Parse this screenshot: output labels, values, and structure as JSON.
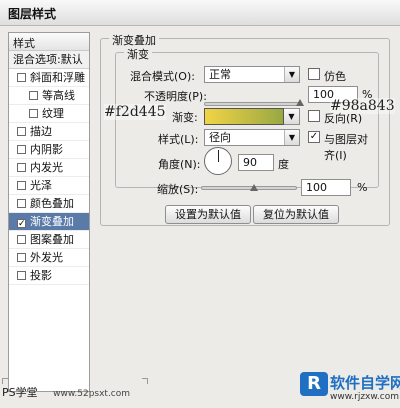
{
  "window": {
    "title": "图层样式"
  },
  "style_list": {
    "header": "样式",
    "blend_options": "混合选项:默认",
    "items": [
      {
        "label": "斜面和浮雕",
        "checked": false,
        "sub": false
      },
      {
        "label": "等高线",
        "checked": false,
        "sub": true
      },
      {
        "label": "纹理",
        "checked": false,
        "sub": true
      },
      {
        "label": "描边",
        "checked": false,
        "sub": false
      },
      {
        "label": "内阴影",
        "checked": false,
        "sub": false
      },
      {
        "label": "内发光",
        "checked": false,
        "sub": false
      },
      {
        "label": "光泽",
        "checked": false,
        "sub": false
      },
      {
        "label": "颜色叠加",
        "checked": false,
        "sub": false
      },
      {
        "label": "渐变叠加",
        "checked": true,
        "sub": false,
        "selected": true
      },
      {
        "label": "图案叠加",
        "checked": false,
        "sub": false
      },
      {
        "label": "外发光",
        "checked": false,
        "sub": false
      },
      {
        "label": "投影",
        "checked": false,
        "sub": false
      }
    ]
  },
  "panel": {
    "section_title": "渐变叠加",
    "group_title": "渐变",
    "blend_mode": {
      "label": "混合模式(O):",
      "value": "正常"
    },
    "dither": {
      "label": "仿色",
      "checked": false
    },
    "opacity": {
      "label": "不透明度(P):",
      "value": "100",
      "unit": "%",
      "level": 1.0
    },
    "gradient": {
      "label": "渐变:",
      "color_start": "#f2d445",
      "color_end": "#98a843"
    },
    "reverse": {
      "label": "反向(R)",
      "checked": false
    },
    "style": {
      "label": "样式(L):",
      "value": "径向"
    },
    "align_with_layer": {
      "label": "与图层对齐(I)",
      "checked": true
    },
    "angle": {
      "label": "角度(N):",
      "value": "90",
      "unit": "度"
    },
    "scale": {
      "label": "缩放(S):",
      "value": "100",
      "unit": "%",
      "level": 0.55
    },
    "buttons": {
      "make_default": "设置为默认值",
      "reset_default": "复位为默认值"
    }
  },
  "annotations": {
    "start_color": "#f2d445",
    "end_color": "#98a843"
  },
  "watermarks": {
    "left_text": "PS学堂",
    "left_url": "www.52psxt.com",
    "logo_name": "软件自学网",
    "logo_url": "www.rjzxw.com",
    "logo_letter": "R"
  }
}
